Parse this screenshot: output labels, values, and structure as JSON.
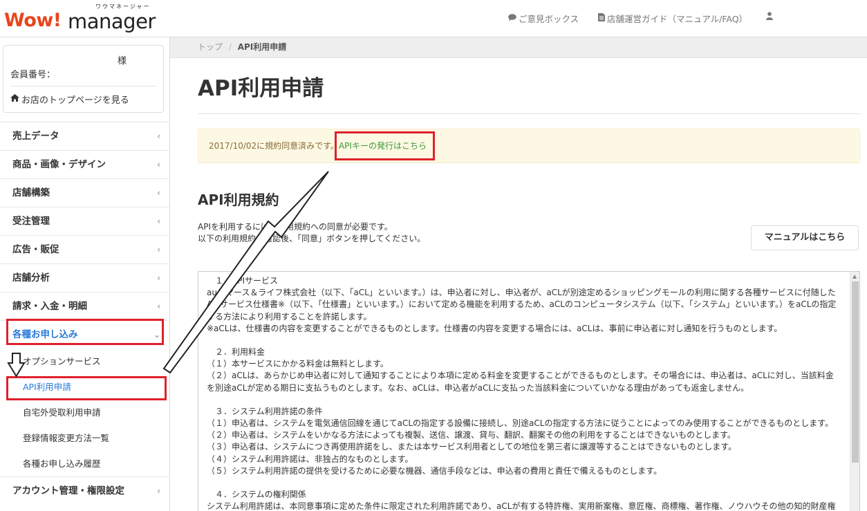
{
  "header": {
    "logo_wow": "Wow!",
    "logo_manager": "manager",
    "logo_kana": "ワウマネージャー",
    "nav": [
      {
        "label": "ご意見ボックス",
        "icon": "comment-icon"
      },
      {
        "label": "店舗運営ガイド（マニュアル/FAQ）",
        "icon": "document-icon"
      }
    ],
    "user_icon": "user-icon"
  },
  "sidebar": {
    "user_suffix": "様",
    "member_label": "会員番号：",
    "top_link": "お店のトップページを見る",
    "menu": [
      {
        "label": "売上データ"
      },
      {
        "label": "商品・画像・デザイン"
      },
      {
        "label": "店舗構築"
      },
      {
        "label": "受注管理"
      },
      {
        "label": "広告・販促"
      },
      {
        "label": "店舗分析"
      },
      {
        "label": "請求・入金・明細"
      },
      {
        "label": "各種お申し込み"
      },
      {
        "label": "アカウント管理・権限設定"
      }
    ],
    "submenu": [
      {
        "label": "オプションサービス"
      },
      {
        "label": "API利用申請"
      },
      {
        "label": "自宅外受取利用申請"
      },
      {
        "label": "登録情報変更方法一覧"
      },
      {
        "label": "各種お申し込み履歴"
      }
    ]
  },
  "breadcrumb": {
    "top": "トップ",
    "sep": "/",
    "current": "API利用申請"
  },
  "main": {
    "title": "API利用申請",
    "alert_text": "2017/10/02に規約同意済みです。",
    "alert_link": "APIキーの発行はこちら",
    "section_title": "API利用規約",
    "intro_line1": "APIを利用するには、利用規約への同意が必要です。",
    "intro_line2": "以下の利用規約を確認後、「同意」ボタンを押してください。",
    "manual_button": "マニュアルはこちら"
  },
  "terms": [
    "１．APIサービス",
    "auコマース＆ライフ株式会社（以下、「aCL」といいます。）は、申込者に対し、申込者が、aCLが別途定めるショッピングモールの利用に関する各種サービスに付随した APIサービス仕様書※（以下、「仕様書」といいます。）において定める機能を利用するため、aCLのコンピュータシステム（以下、「システム」といいます。）をaCLの指定する方法により利用することを許諾します。",
    "※aCLは、仕様書の内容を変更することができるものとします。仕様書の内容を変更する場合には、aCLは、事前に申込者に対し通知を行うものとします。",
    "",
    "２．利用料金",
    "（１）本サービスにかかる料金は無料とします。",
    "（２）aCLは、あらかじめ申込者に対して通知することにより本項に定める料金を変更することができるものとします。その場合には、申込者は、aCLに対し、当該料金を別途aCLが定める期日に支払うものとします。なお、aCLは、申込者がaCLに支払った当該料金についていかなる理由があっても返金しません。",
    "",
    "３．システム利用許諾の条件",
    "（１）申込者は、システムを電気通信回線を通じてaCLの指定する設備に接続し、別途aCLの指定する方法に従うことによってのみ使用することができるものとします。",
    "（２）申込者は、システムをいかなる方法によっても複製、送信、譲渡、貸与、翻訳、翻案その他の利用をすることはできないものとします。",
    "（３）申込者は、システムにつき再使用許諾をし、または本サービス利用者としての地位を第三者に譲渡等することはできないものとします。",
    "（４）システム利用許諾は、非独占的なものとします。",
    "（５）システム利用許諾の提供を受けるために必要な機器、通信手段などは、申込者の費用と責任で備えるものとします。",
    "",
    "４．システムの権利関係",
    "システム利用許諾は、本同意事項に定めた条件に限定された利用許諾であり、aCLが有する特許権、実用新案権、意匠権、商標権、著作権、ノウハウその他の知的財産権"
  ],
  "colors": {
    "accent": "#2a7ad6",
    "highlight": "#e0202a",
    "alert_bg": "#fcf8e3",
    "link_green": "#3c9a3c",
    "logo_red": "#e8461c"
  }
}
